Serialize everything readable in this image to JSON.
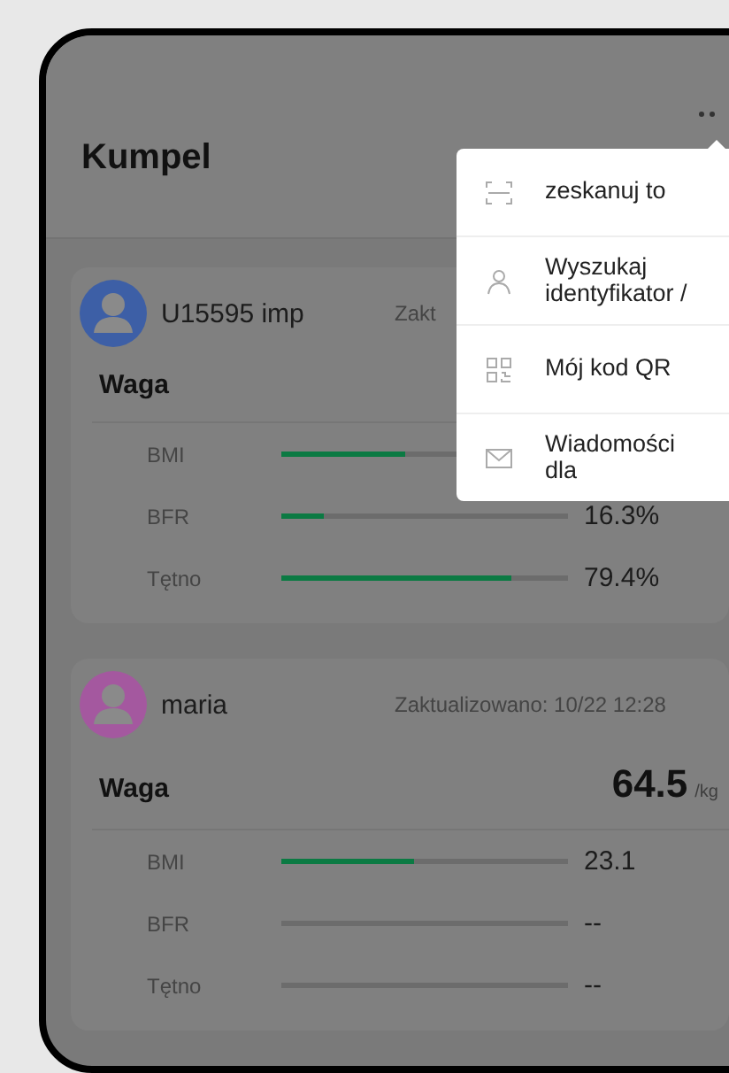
{
  "header": {
    "title": "Kumpel"
  },
  "menu": {
    "items": [
      {
        "kind": "scan",
        "label": "zeskanuj to"
      },
      {
        "kind": "person",
        "label": "Wyszukaj identyfikator /"
      },
      {
        "kind": "qr",
        "label": "Mój kod QR"
      },
      {
        "kind": "mail",
        "label": "Wiadomości dla"
      }
    ]
  },
  "friends": [
    {
      "name": "U15595 imp",
      "color": "#3d5fa6",
      "updated": "Zakt",
      "weight_label": "Waga",
      "metrics": [
        {
          "label": "BMI",
          "level": 0.43
        },
        {
          "label": "BFR",
          "level": 0.15,
          "reading": "16.3%"
        },
        {
          "label": "Tętno",
          "level": 0.8,
          "reading": "79.4%"
        }
      ]
    },
    {
      "name": "maria",
      "color": "#a4589f",
      "updated": "Zaktualizowano: 10/22 12:28",
      "weight_label": "Waga",
      "weight": "64.5",
      "unit": "/kg",
      "metrics": [
        {
          "label": "BMI",
          "level": 0.46,
          "reading": "23.1"
        },
        {
          "label": "BFR",
          "reading": "--"
        },
        {
          "label": "Tętno",
          "reading": "--"
        }
      ]
    }
  ]
}
